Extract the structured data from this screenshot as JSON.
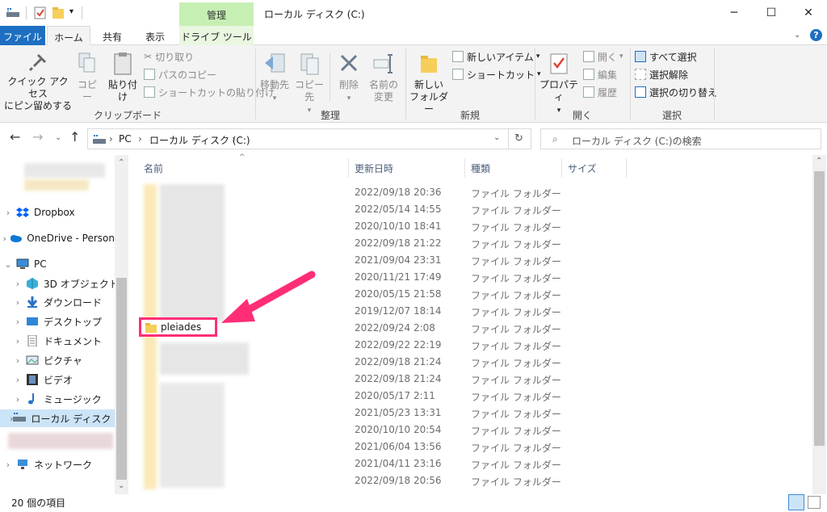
{
  "titlebar": {
    "manage_tab": "管理",
    "title": "ローカル ディスク (C:)",
    "minimize": "─",
    "maximize": "☐",
    "close": "✕"
  },
  "ribbon_tabs": {
    "file": "ファイル",
    "home": "ホーム",
    "share": "共有",
    "view": "表示",
    "drive_tools": "ドライブ ツール",
    "help": "?"
  },
  "ribbon": {
    "clipboard": {
      "pin_quick_access_1": "クイック アクセス",
      "pin_quick_access_2": "にピン留めする",
      "copy": "コピー",
      "paste": "貼り付け",
      "cut": "切り取り",
      "copy_path": "パスのコピー",
      "paste_shortcut": "ショートカットの貼り付け",
      "label": "クリップボード"
    },
    "organize": {
      "move_to": "移動先",
      "copy_to": "コピー先",
      "delete": "削除",
      "rename_1": "名前の",
      "rename_2": "変更",
      "label": "整理"
    },
    "new": {
      "new_item": "新しいアイテム",
      "shortcut": "ショートカット",
      "new_folder_1": "新しい",
      "new_folder_2": "フォルダー",
      "label": "新規"
    },
    "open": {
      "properties": "プロパティ",
      "open": "開く",
      "edit": "編集",
      "history": "履歴",
      "label": "開く"
    },
    "select": {
      "select_all": "すべて選択",
      "select_none": "選択解除",
      "invert": "選択の切り替え",
      "label": "選択"
    }
  },
  "address": {
    "path_pc": "PC",
    "path_drive": "ローカル ディスク (C:)",
    "search_placeholder": "ローカル ディスク (C:)の検索"
  },
  "nav": {
    "dropbox": "Dropbox",
    "onedrive": "OneDrive - Person",
    "pc": "PC",
    "objects3d": "3D オブジェクト",
    "downloads": "ダウンロード",
    "desktop": "デスクトップ",
    "documents": "ドキュメント",
    "pictures": "ピクチャ",
    "videos": "ビデオ",
    "music": "ミュージック",
    "local_disk": "ローカル ディスク (C",
    "network": "ネットワーク"
  },
  "columns": {
    "name": "名前",
    "date": "更新日時",
    "type": "種類",
    "size": "サイズ"
  },
  "files": [
    {
      "name": "",
      "date": "2022/09/18 20:36",
      "type": "ファイル フォルダー"
    },
    {
      "name": "",
      "date": "2022/05/14 14:55",
      "type": "ファイル フォルダー"
    },
    {
      "name": "",
      "date": "2020/10/10 18:41",
      "type": "ファイル フォルダー"
    },
    {
      "name": "",
      "date": "2022/09/18 21:22",
      "type": "ファイル フォルダー"
    },
    {
      "name": "",
      "date": "2021/09/04 23:31",
      "type": "ファイル フォルダー"
    },
    {
      "name": "",
      "date": "2020/11/21 17:49",
      "type": "ファイル フォルダー"
    },
    {
      "name": "",
      "date": "2020/05/15 21:58",
      "type": "ファイル フォルダー"
    },
    {
      "name": "",
      "date": "2019/12/07 18:14",
      "type": "ファイル フォルダー"
    },
    {
      "name": "pleiades",
      "date": "2022/09/24 2:08",
      "type": "ファイル フォルダー"
    },
    {
      "name": "",
      "date": "2022/09/22 22:19",
      "type": "ファイル フォルダー"
    },
    {
      "name": "",
      "date": "2022/09/18 21:24",
      "type": "ファイル フォルダー"
    },
    {
      "name": "",
      "date": "2022/09/18 21:24",
      "type": "ファイル フォルダー"
    },
    {
      "name": "",
      "date": "2020/05/17 2:11",
      "type": "ファイル フォルダー"
    },
    {
      "name": "",
      "date": "2021/05/23 13:31",
      "type": "ファイル フォルダー"
    },
    {
      "name": "",
      "date": "2020/10/10 20:54",
      "type": "ファイル フォルダー"
    },
    {
      "name": "",
      "date": "2021/06/04 13:56",
      "type": "ファイル フォルダー"
    },
    {
      "name": "",
      "date": "2021/04/11 23:16",
      "type": "ファイル フォルダー"
    },
    {
      "name": "",
      "date": "2022/09/18 20:56",
      "type": "ファイル フォルダー"
    }
  ],
  "status": {
    "count": "20 個の項目"
  },
  "colors": {
    "highlight": "#ff2d78",
    "file_tab": "#1e6fc1",
    "manage_tab": "#c6efb4"
  }
}
